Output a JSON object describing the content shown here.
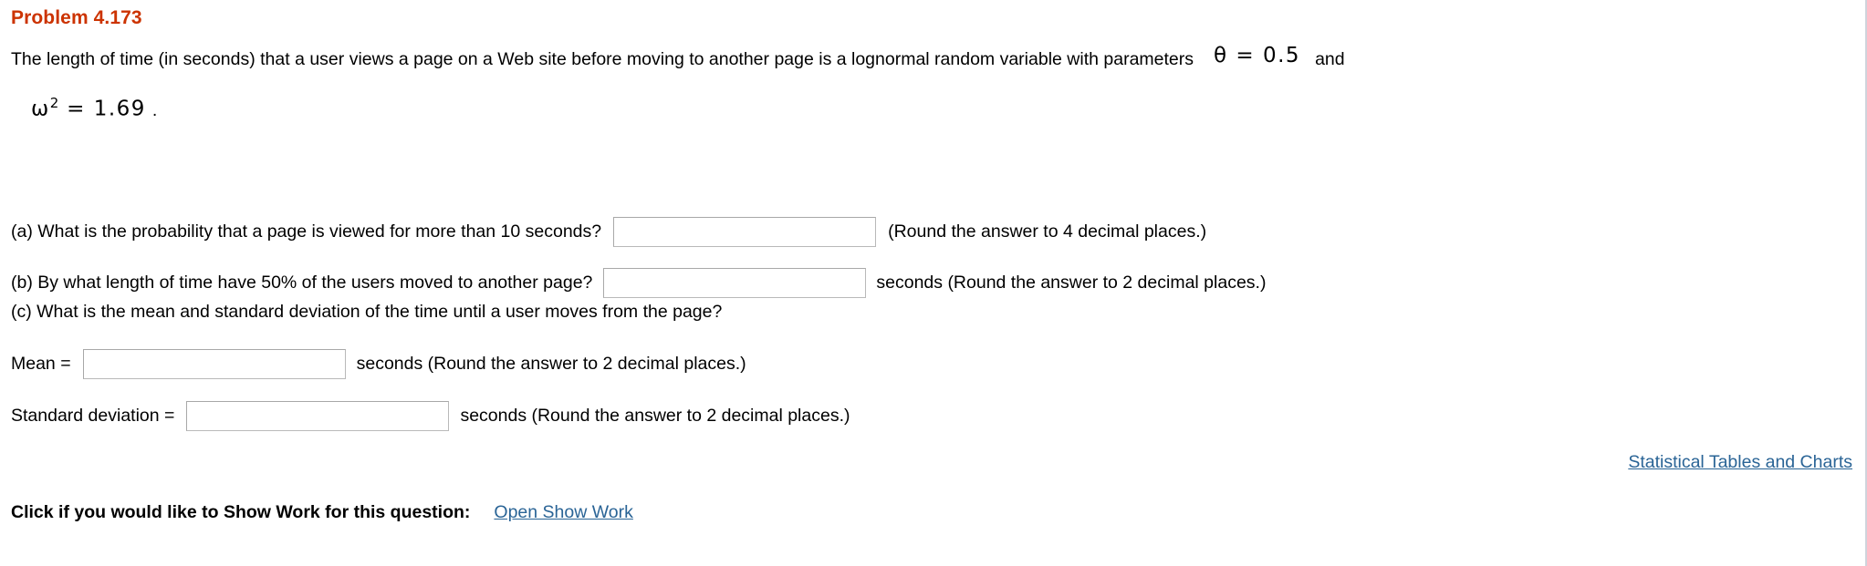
{
  "problem": {
    "title": "Problem 4.173",
    "title_color": "#cc3300"
  },
  "statement": {
    "text_before_math": "The length of time (in seconds) that a user views a page on a Web site before moving to another page is a lognormal random variable with parameters",
    "math_theta": "θ = 0.5",
    "text_after_math": "and",
    "math_omega_base": "ω",
    "math_omega_exponent": "2",
    "math_omega_value": "= 1.69",
    "math_omega_period": "."
  },
  "parts": {
    "a": {
      "label": "(a) What is the probability that a page is viewed for more than 10 seconds?",
      "answer_value": "",
      "answer_placeholder": "",
      "trailing": "(Round the answer to 4 decimal places.)"
    },
    "b": {
      "label": "(b) By what length of time have 50% of the users moved to another page?",
      "answer_value": "",
      "answer_placeholder": "",
      "trailing": "seconds (Round the answer to 2 decimal places.)"
    },
    "c": {
      "label": "(c) What is the mean and standard deviation of the time until a user moves from the page?"
    },
    "mean": {
      "label": "Mean =",
      "answer_value": "",
      "answer_placeholder": "",
      "trailing": "seconds (Round the answer to 2 decimal places.)"
    },
    "standard_deviation": {
      "label": "Standard deviation =",
      "answer_value": "",
      "answer_placeholder": "",
      "trailing": "seconds (Round the answer to 2 decimal places.)"
    }
  },
  "links": {
    "statistical_tables": "Statistical Tables and Charts",
    "statistical_tables_color": "#2a6496",
    "show_work_prompt": "Click if you would like to Show Work for this question:",
    "show_work_link": "Open Show Work",
    "show_work_link_color": "#2a6496"
  }
}
